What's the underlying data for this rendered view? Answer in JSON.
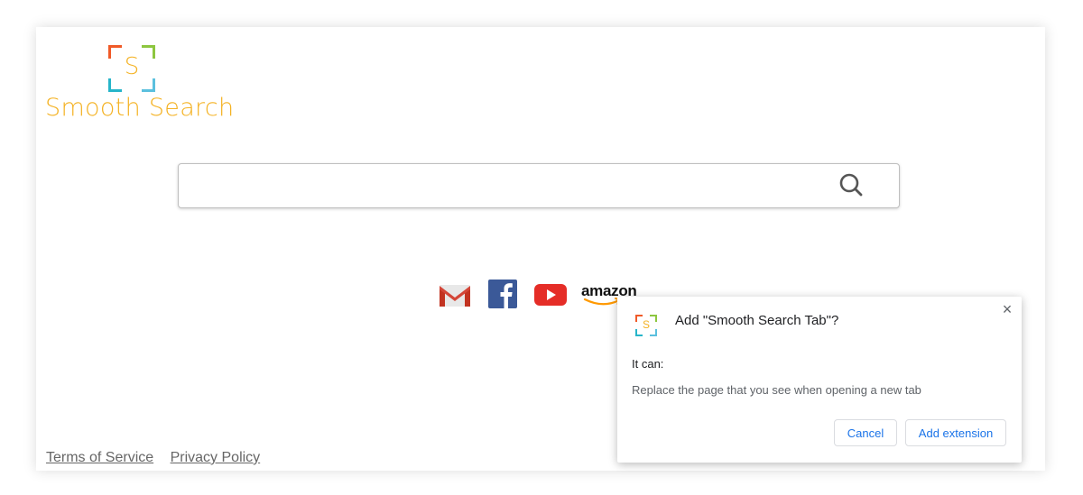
{
  "logo": {
    "mark_letter": "S",
    "name": "Smooth Search"
  },
  "search": {
    "value": "",
    "placeholder": ""
  },
  "quick_links": [
    {
      "name": "Gmail",
      "icon": "gmail-icon"
    },
    {
      "name": "Facebook",
      "icon": "facebook-icon"
    },
    {
      "name": "YouTube",
      "icon": "youtube-icon"
    },
    {
      "name": "amazon",
      "icon": "amazon-icon"
    }
  ],
  "footer": {
    "terms": "Terms of Service",
    "privacy": "Privacy Policy"
  },
  "dialog": {
    "icon_letter": "S",
    "title": "Add \"Smooth Search Tab\"?",
    "subhead": "It can:",
    "permission": "Replace the page that you see when opening a new tab",
    "cancel": "Cancel",
    "add": "Add extension",
    "close_glyph": "×"
  },
  "colors": {
    "brand": "#f4b223",
    "accent_blue": "#1a73e8",
    "logo_orange": "#f05a28",
    "logo_green": "#8dc63f",
    "logo_teal": "#27b5c9"
  }
}
